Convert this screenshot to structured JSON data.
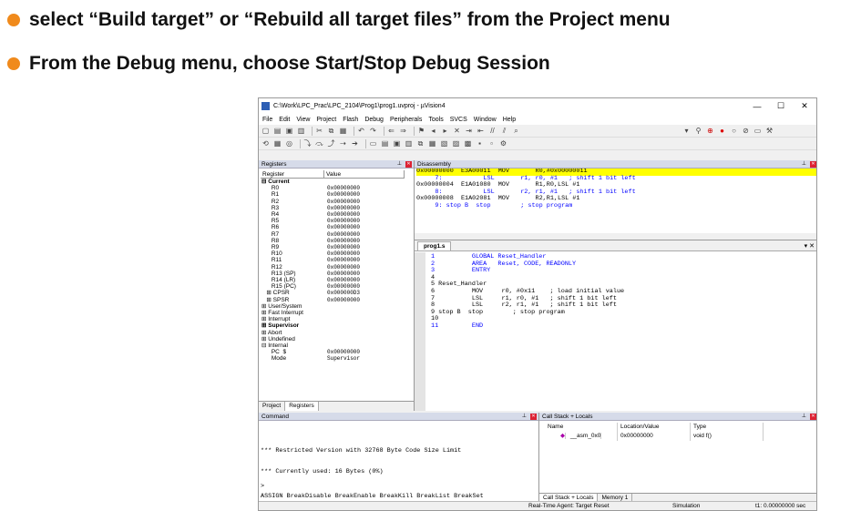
{
  "slide": {
    "bullet1": "select “Build target” or “Rebuild all target files” from the Project menu",
    "bullet2": "From the Debug menu, choose Start/Stop Debug Session",
    "bullet_color": "#f08a1c"
  },
  "window": {
    "title": "C:\\Work\\LPC_Prac\\LPC_2104\\Prog1\\prog1.uvproj - µVision4",
    "controls": {
      "minimize": "—",
      "maximize": "☐",
      "close": "✕"
    }
  },
  "menu": [
    "File",
    "Edit",
    "View",
    "Project",
    "Flash",
    "Debug",
    "Peripherals",
    "Tools",
    "SVCS",
    "Window",
    "Help"
  ],
  "registers": {
    "header": "Registers",
    "col_register": "Register",
    "col_value": "Value",
    "rows": [
      {
        "n": "⊟ Current",
        "v": "",
        "b": true
      },
      {
        "n": "      R0",
        "v": "0x00000000"
      },
      {
        "n": "      R1",
        "v": "0x00000000"
      },
      {
        "n": "      R2",
        "v": "0x00000000"
      },
      {
        "n": "      R3",
        "v": "0x00000000"
      },
      {
        "n": "      R4",
        "v": "0x00000000"
      },
      {
        "n": "      R5",
        "v": "0x00000000"
      },
      {
        "n": "      R6",
        "v": "0x00000000"
      },
      {
        "n": "      R7",
        "v": "0x00000000"
      },
      {
        "n": "      R8",
        "v": "0x00000000"
      },
      {
        "n": "      R9",
        "v": "0x00000000"
      },
      {
        "n": "      R10",
        "v": "0x00000000"
      },
      {
        "n": "      R11",
        "v": "0x00000000"
      },
      {
        "n": "      R12",
        "v": "0x00000000"
      },
      {
        "n": "      R13 (SP)",
        "v": "0x00000000"
      },
      {
        "n": "      R14 (LR)",
        "v": "0x00000000"
      },
      {
        "n": "      R15 (PC)",
        "v": "0x00000000"
      },
      {
        "n": "   ⊞ CPSR",
        "v": "0x000000D3"
      },
      {
        "n": "   ⊞ SPSR",
        "v": "0x00000000"
      },
      {
        "n": "⊞ User/System",
        "v": ""
      },
      {
        "n": "⊞ Fast Interrupt",
        "v": ""
      },
      {
        "n": "⊞ Interrupt",
        "v": ""
      },
      {
        "n": "⊞ Supervisor",
        "v": "",
        "b": true
      },
      {
        "n": "⊞ Abort",
        "v": ""
      },
      {
        "n": "⊞ Undefined",
        "v": ""
      },
      {
        "n": "⊟ Internal",
        "v": ""
      },
      {
        "n": "      PC  $",
        "v": "0x00000000"
      },
      {
        "n": "      Mode",
        "v": "Supervisor"
      }
    ],
    "tab_project": "Project",
    "tab_registers": "Registers"
  },
  "disassembly": {
    "header": "Disassembly",
    "lines": [
      "0x00000000  E3A00011  MOV       R0,#0x00000011",
      "     7:           LSL       r1, r0, #1   ; shift 1 bit left",
      "0x00000004  E1A01080  MOV       R1,R0,LSL #1",
      "     8:           LSL       r2, r1, #1   ; shift 1 bit left",
      "0x00000008  E1A02081  MOV       R2,R1,LSL #1",
      "     9: stop B  stop        ; stop program"
    ]
  },
  "source": {
    "tab": "prog1.s",
    "lines": [
      "1          GLOBAL Reset_Handler",
      "2          AREA   Reset, CODE, READONLY",
      "3          ENTRY",
      "4",
      "5 Reset_Handler",
      "6          MOV     r0, #0x11    ; load initial value",
      "7          LSL     r1, r0, #1   ; shift 1 bit left",
      "8          LSL     r2, r1, #1   ; shift 1 bit left",
      "9 stop B  stop        ; stop program",
      "10",
      "11         END"
    ]
  },
  "command": {
    "header": "Command",
    "line1": "*** Restricted Version with 32768 Byte Code Size Limit",
    "line2": "*** Currently used: 16 Bytes (0%)",
    "prompt": ">",
    "hint": "ASSIGN BreakDisable BreakEnable BreakKill BreakList BreakSet"
  },
  "callstack": {
    "header": "Call Stack + Locals",
    "col_name": "Name",
    "col_loc": "Location/Value",
    "col_type": "Type",
    "row_name": "__asm_0x0",
    "row_loc": "0x00000000",
    "row_type": "void f()",
    "tab1": "Call Stack + Locals",
    "tab2": "Memory 1"
  },
  "status": {
    "agent": "Real-Time Agent: Target Reset",
    "mode": "Simulation",
    "time": "t1: 0.00000000 sec"
  }
}
